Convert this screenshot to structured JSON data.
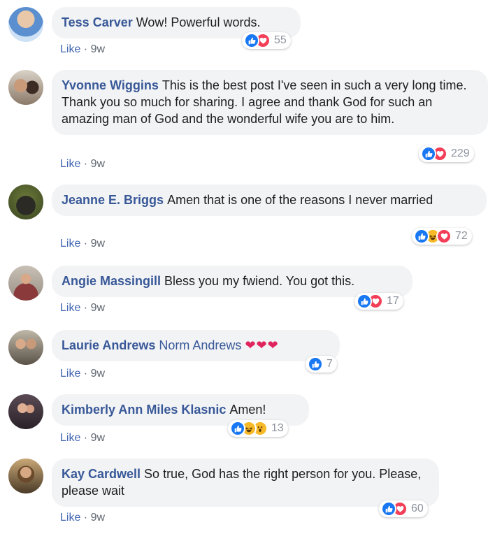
{
  "comments": [
    {
      "name": "Tess Carver",
      "text": "Wow! Powerful words.",
      "mention": "",
      "emoji": "",
      "like": "Like",
      "time": "9w",
      "reactions": [
        "like",
        "love"
      ],
      "count": "55"
    },
    {
      "name": "Yvonne Wiggins",
      "text": "This is the best post I've seen in such a very long time. Thank you so much for sharing. I agree and thank God for such an amazing man of God and the wonderful wife you are to him.",
      "mention": "",
      "emoji": "",
      "like": "Like",
      "time": "9w",
      "reactions": [
        "like",
        "love"
      ],
      "count": "229"
    },
    {
      "name": "Jeanne E. Briggs",
      "text": "Amen that is one of the reasons I never married",
      "mention": "",
      "emoji": "",
      "like": "Like",
      "time": "9w",
      "reactions": [
        "like",
        "haha",
        "love"
      ],
      "count": "72"
    },
    {
      "name": "Angie Massingill",
      "text": "Bless you my fwiend. You got this.",
      "mention": "",
      "emoji": "",
      "like": "Like",
      "time": "9w",
      "reactions": [
        "like",
        "love"
      ],
      "count": "17"
    },
    {
      "name": "Laurie Andrews",
      "text": "",
      "mention": "Norm Andrews",
      "emoji": "❤❤❤",
      "like": "Like",
      "time": "9w",
      "reactions": [
        "like"
      ],
      "count": "7"
    },
    {
      "name": "Kimberly Ann Miles Klasnic",
      "text": "Amen!",
      "mention": "",
      "emoji": "",
      "like": "Like",
      "time": "9w",
      "reactions": [
        "like",
        "haha",
        "wow"
      ],
      "count": "13"
    },
    {
      "name": "Kay Cardwell",
      "text": "So true, God has the right person for you. Please, please wait",
      "mention": "",
      "emoji": "",
      "like": "Like",
      "time": "9w",
      "reactions": [
        "like",
        "love"
      ],
      "count": "60"
    }
  ],
  "colors": {
    "link": "#385898",
    "like_blue": "#1877f2",
    "love_red": "#f33e58",
    "haha_yellow": "#f7b928"
  },
  "icons": {
    "like": "thumbs-up-icon",
    "love": "heart-icon",
    "haha": "laughing-face-icon",
    "wow": "surprised-face-icon"
  }
}
